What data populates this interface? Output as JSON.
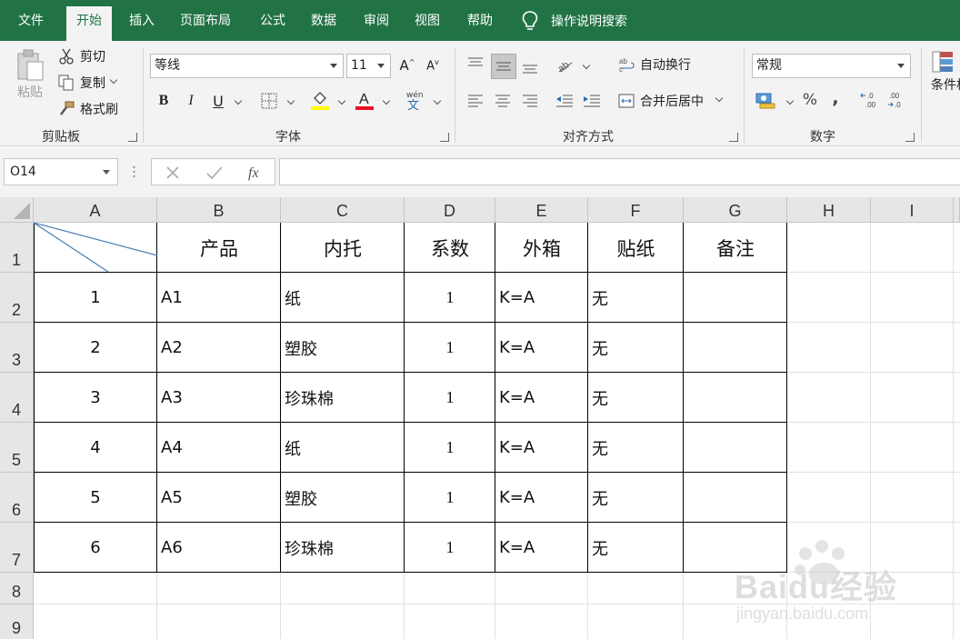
{
  "ribbon_tabs": [
    "文件",
    "开始",
    "插入",
    "页面布局",
    "公式",
    "数据",
    "审阅",
    "视图",
    "帮助"
  ],
  "active_tab": "开始",
  "tell_me": "操作说明搜索",
  "clipboard": {
    "paste": "粘贴",
    "cut": "剪切",
    "copy": "复制",
    "format_painter": "格式刷",
    "label": "剪贴板"
  },
  "font": {
    "name": "等线",
    "size": "11",
    "label": "字体",
    "pinyin": "wén"
  },
  "alignment": {
    "wrap_text": "自动换行",
    "merge_center": "合并后居中",
    "label": "对齐方式"
  },
  "number": {
    "format": "常规",
    "label": "数字",
    "percent": "%",
    "comma": ",",
    "inc_decimal": "←.0 .00",
    "dec_decimal": ".00 →.0"
  },
  "styles": {
    "conditional_format": "条件格"
  },
  "name_box": "O14",
  "colors": {
    "accent": "#217346",
    "font_color": "#e81123",
    "highlight": "#ffff00"
  },
  "columns": [
    "A",
    "B",
    "C",
    "D",
    "E",
    "F",
    "G",
    "H",
    "I"
  ],
  "rows": [
    "1",
    "2",
    "3",
    "4",
    "5",
    "6",
    "7",
    "8",
    "9"
  ],
  "sheet": {
    "headers": [
      "产品",
      "内托",
      "系数",
      "外箱",
      "贴纸",
      "备注"
    ],
    "data": [
      [
        "1",
        "A1",
        "纸",
        "1",
        "K=A",
        "无",
        ""
      ],
      [
        "2",
        "A2",
        "塑胶",
        "1",
        "K=A",
        "无",
        ""
      ],
      [
        "3",
        "A3",
        "珍珠棉",
        "1",
        "K=A",
        "无",
        ""
      ],
      [
        "4",
        "A4",
        "纸",
        "1",
        "K=A",
        "无",
        ""
      ],
      [
        "5",
        "A5",
        "塑胶",
        "1",
        "K=A",
        "无",
        ""
      ],
      [
        "6",
        "A6",
        "珍珠棉",
        "1",
        "K=A",
        "无",
        ""
      ]
    ]
  },
  "watermark": {
    "brand": "Baidu经验",
    "url": "jingyan.baidu.com"
  }
}
